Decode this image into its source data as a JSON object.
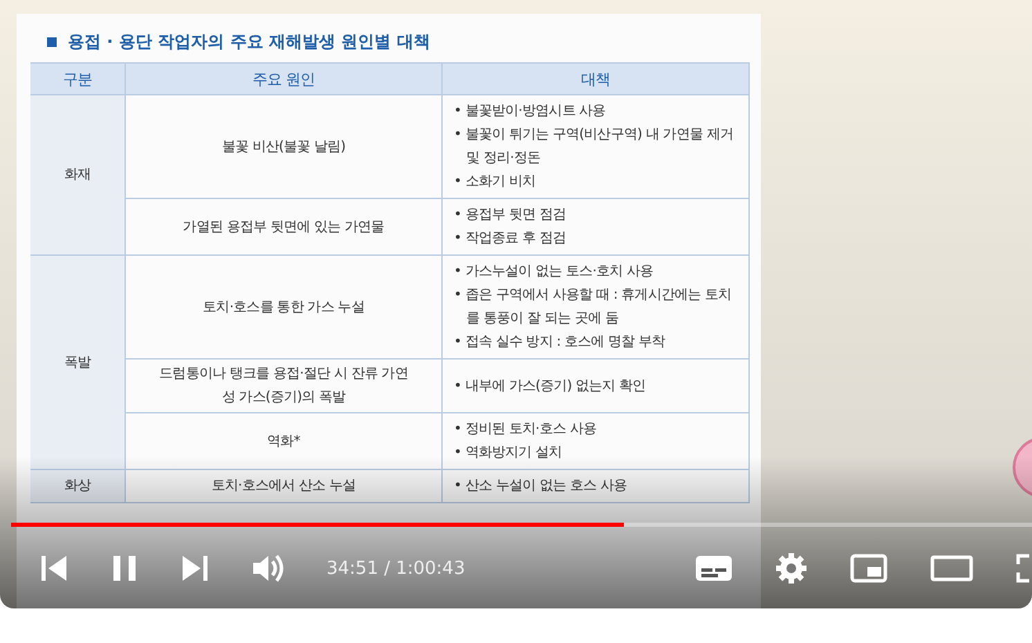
{
  "slide": {
    "title": "용접 · 용단 작업자의 주요 재해발생 원인별 대책",
    "columns": [
      "구분",
      "주요 원인",
      "대책"
    ],
    "groups": [
      {
        "category": "화재",
        "rows": [
          {
            "cause": "불꽃 비산(불꽃 날림)",
            "measures": [
              "• 불꽃받이·방염시트 사용",
              "• 불꽃이 튀기는 구역(비산구역) 내 가연물 제거 및 정리·정돈",
              "• 소화기 비치"
            ]
          },
          {
            "cause": "가열된 용접부 뒷면에 있는 가연물",
            "measures": [
              "• 용접부 뒷면 점검",
              "• 작업종료 후 점검"
            ]
          }
        ]
      },
      {
        "category": "폭발",
        "rows": [
          {
            "cause": "토치·호스를 통한 가스 누설",
            "measures": [
              "• 가스누설이 없는 토스·호치 사용",
              "• 좁은 구역에서 사용할 때 : 휴게시간에는 토치를 통풍이 잘 되는 곳에 둠",
              "• 접속 실수 방지 : 호스에 명찰 부착"
            ]
          },
          {
            "cause": "드럼통이나 탱크를 용접·절단 시 잔류 가연성 가스(증기)의 폭발",
            "measures": [
              "• 내부에 가스(증기) 없는지 확인"
            ]
          },
          {
            "cause": "역화*",
            "measures": [
              "• 정비된 토치·호스 사용",
              "• 역화방지기 설치"
            ]
          }
        ]
      },
      {
        "category": "화상",
        "rows": [
          {
            "cause": "토치·호스에서 산소 누설",
            "measures": [
              "• 산소 누설이 없는 호스 사용"
            ]
          }
        ]
      }
    ]
  },
  "player": {
    "playing": true,
    "level": 0.6,
    "time": "34:51 / 1:00:43"
  }
}
